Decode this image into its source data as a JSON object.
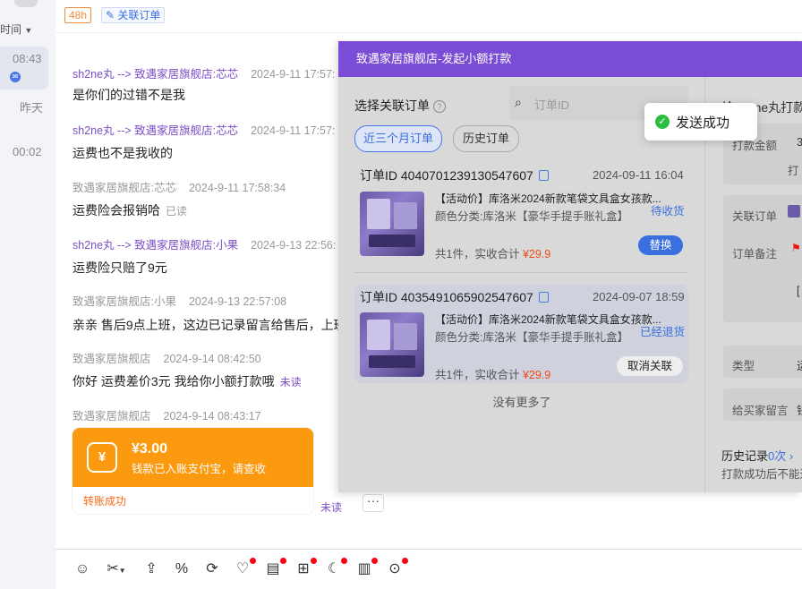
{
  "rail": {
    "sort_label": "时间",
    "times": [
      "08:43",
      "昨天",
      "00:02"
    ]
  },
  "topbar": {
    "tag_48h": "48h",
    "link_order": "关联订单"
  },
  "messages": [
    {
      "sender": "sh2ne丸 --> 致遇家居旗舰店:芯芯",
      "time": "2024-9-11 17:57:",
      "text": "是你们的过错不是我",
      "status": ""
    },
    {
      "sender": "sh2ne丸 --> 致遇家居旗舰店:芯芯",
      "time": "2024-9-11 17:57:",
      "text": "运费也不是我收的",
      "status": ""
    },
    {
      "sender": "致遇家居旗舰店:芯芯",
      "time": "2024-9-11 17:58:34",
      "text": "运费险会报销哈",
      "status": "已读"
    },
    {
      "sender": "sh2ne丸 --> 致遇家居旗舰店:小果",
      "time": "2024-9-13 22:56:",
      "text": "运费险只赔了9元",
      "status": ""
    },
    {
      "sender": "致遇家居旗舰店:小果",
      "time": "2024-9-13 22:57:08",
      "text": "亲亲 售后9点上班，这边已记录留言给售后，上班",
      "status": ""
    },
    {
      "sender": "致遇家居旗舰店",
      "time": "2024-9-14 08:42:50",
      "text": "你好 运费差价3元 我给你小额打款哦",
      "status": "未读"
    },
    {
      "sender": "致遇家居旗舰店",
      "time": "2024-9-14 08:43:17",
      "text": "",
      "status": ""
    }
  ],
  "transfer": {
    "icon": "¥",
    "amount": "¥3.00",
    "desc": "钱款已入账支付宝，请查收",
    "footer": "转账成功",
    "status": "未读",
    "more": "···"
  },
  "toolbar": {
    "icons": [
      "smile-icon",
      "scissors-icon",
      "upload-icon",
      "percent-icon",
      "refresh-icon",
      "coupon-icon",
      "note-icon",
      "add-image-icon",
      "moon-icon",
      "doc-icon",
      "search-image-icon"
    ]
  },
  "dialog": {
    "title": "致遇家居旗舰店-发起小额打款",
    "right_title": "给sh2ne丸打款",
    "select_label": "选择关联订单",
    "search_placeholder": "订单ID",
    "tabs": [
      "近三个月订单",
      "历史订单"
    ],
    "orders": [
      {
        "id": "订单ID 4040701239130547607",
        "date": "2024-09-11 16:04",
        "title": "【活动价】库洛米2024新款笔袋文具盒女孩款...",
        "sku": "颜色分类:库洛米【豪华手提手账礼盒】",
        "status": "待收货",
        "total_prefix": "共1件，实收合计 ",
        "price": "¥29.9",
        "action": "替换"
      },
      {
        "id": "订单ID 4035491065902547607",
        "date": "2024-09-07 18:59",
        "title": "【活动价】库洛米2024新款笔袋文具盒女孩款...",
        "sku": "颜色分类:库洛米【豪华手提手账礼盒】",
        "status": "已经退货",
        "total_prefix": "共1件，实收合计 ",
        "price": "¥29.9",
        "action": "取消关联"
      }
    ],
    "no_more": "没有更多了",
    "right": {
      "amount_label": "打款金额",
      "amount_value": "3",
      "amount_sub": "打",
      "link_label": "关联订单",
      "remark_label": "订单备注",
      "remark_value": "[",
      "type_label": "类型",
      "type_value": "运",
      "buyer_msg_label": "给买家留言",
      "buyer_msg_value": "钱",
      "history_label": "历史记录",
      "history_count": "0次",
      "history_sub": "打款成功后不能进"
    }
  },
  "toast": {
    "text": "发送成功"
  }
}
